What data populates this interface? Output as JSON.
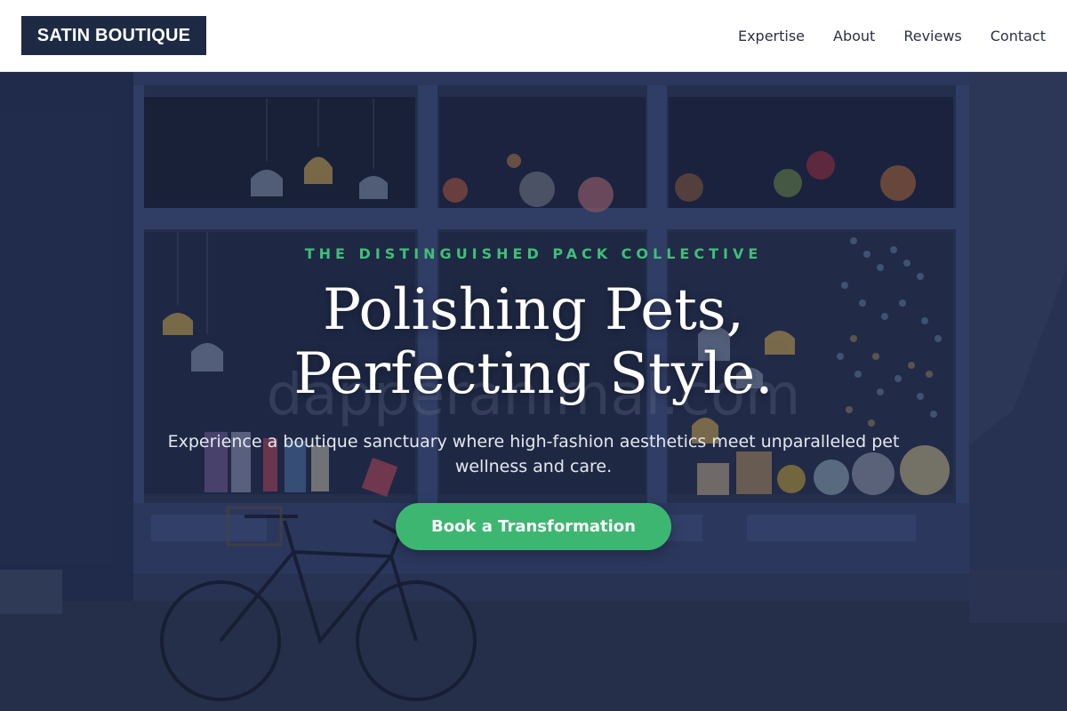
{
  "brand": {
    "name": "SATIN BOUTIQUE"
  },
  "nav": {
    "items": [
      {
        "label": "Expertise"
      },
      {
        "label": "About"
      },
      {
        "label": "Reviews"
      },
      {
        "label": "Contact"
      }
    ]
  },
  "hero": {
    "kicker": "THE DISTINGUISHED PACK COLLECTIVE",
    "headline": "Polishing Pets, Perfecting Style.",
    "subtext": "Experience a boutique sanctuary where high-fashion aesthetics meet unparalleled pet wellness and care.",
    "cta_label": "Book a Transformation",
    "background_text": "dapperanimal.com"
  },
  "colors": {
    "brand_dark": "#1e2a44",
    "accent_green": "#3db671",
    "kicker_green": "#3fbf7a"
  }
}
